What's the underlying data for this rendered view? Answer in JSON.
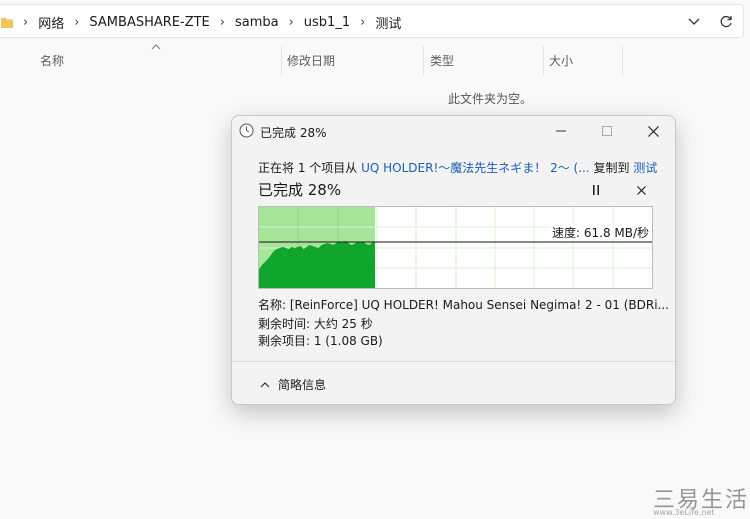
{
  "address_bar": {
    "crumbs": [
      "网络",
      "SAMBASHARE-ZTE",
      "samba",
      "usb1_1",
      "测试"
    ]
  },
  "columns": {
    "name": "名称",
    "modified": "修改日期",
    "type": "类型",
    "size": "大小"
  },
  "empty_message": "此文件夹为空。",
  "dialog": {
    "title": "已完成 28%",
    "status_prefix": "正在将 1 个项目从 ",
    "source": "UQ HOLDER!～魔法先生ネギま！ 2～ (...",
    "copy_to": " 复制到 ",
    "destination": "测试",
    "percent_label": "已完成 28%",
    "progress": 0.28,
    "speed": "速度: 61.8 MB/秒",
    "name_line": "名称:  [ReinForce] UQ HOLDER! Mahou Sensei Negima! 2 - 01 (BDRi...",
    "time_line": "剩余时间: 大约 25 秒",
    "items_line": "剩余项目: 1 (1.08 GB)",
    "details_label": "简略信息"
  },
  "watermark": {
    "text": "三易生活",
    "url": "www.3eLife.net"
  },
  "colors": {
    "link": "#1a5fb4",
    "graph_fill": "#10a52c",
    "graph_done_bg": "#a6e59a"
  }
}
